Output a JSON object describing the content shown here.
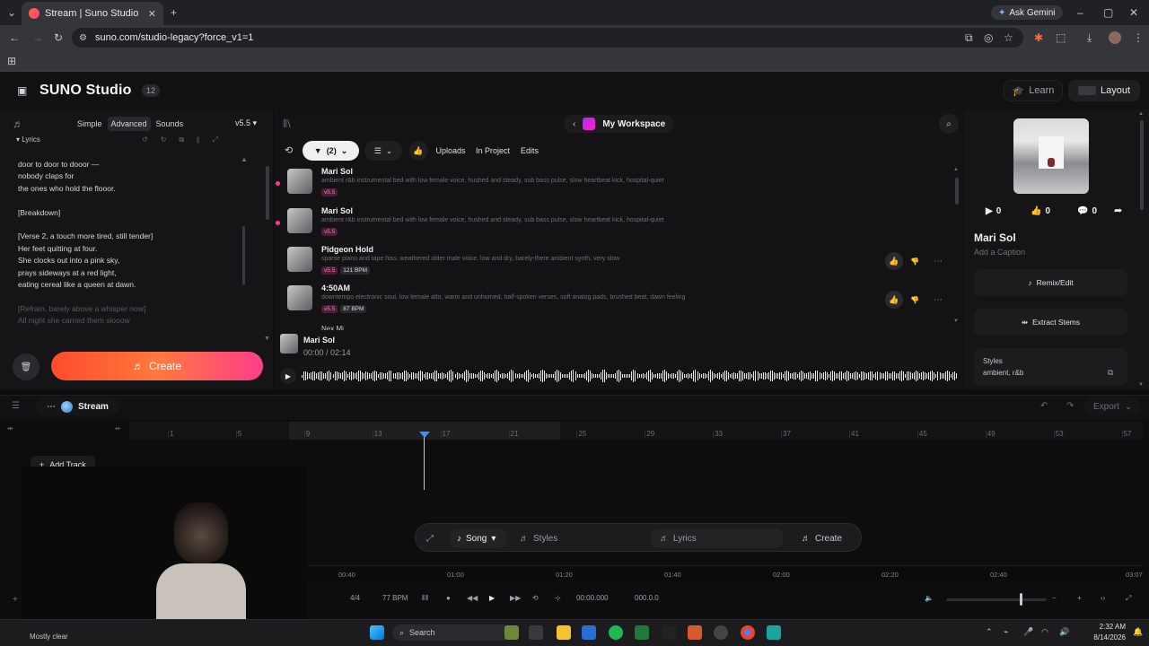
{
  "browser": {
    "tab_title": "Stream | Suno Studio",
    "url": "suno.com/studio-legacy?force_v1=1",
    "ask_gemini": "Ask Gemini"
  },
  "header": {
    "logo": "SUNO Studio",
    "badge": "12",
    "learn": "Learn",
    "layout": "Layout"
  },
  "left": {
    "tabs": [
      "Simple",
      "Advanced",
      "Sounds"
    ],
    "version": "v5.5",
    "lyrics_label": "Lyrics",
    "lyrics_lines": [
      {
        "t": "door to door to dooor —",
        "dim": false
      },
      {
        "t": "nobody claps for",
        "dim": false
      },
      {
        "t": "the ones who hold the flooor.",
        "dim": false
      },
      {
        "t": "",
        "dim": false
      },
      {
        "t": "[Breakdown]",
        "dim": false
      },
      {
        "t": "",
        "dim": false
      },
      {
        "t": "[Verse 2, a touch more tired, still tender]",
        "dim": false
      },
      {
        "t": "Her feet quitting at four.",
        "dim": false
      },
      {
        "t": "She clocks out into a pink sky,",
        "dim": false
      },
      {
        "t": "prays sideways at a red light,",
        "dim": false
      },
      {
        "t": "eating cereal like a queen at dawn.",
        "dim": false
      },
      {
        "t": "",
        "dim": false
      },
      {
        "t": "[Refrain, barely above a whisper now]",
        "dim": true
      },
      {
        "t": "All night she carried them slooow",
        "dim": true
      }
    ],
    "create": "Create"
  },
  "mid": {
    "workspace": "My Workspace",
    "filter_count": "(2)",
    "filters": [
      "Uploads",
      "In Project",
      "Edits"
    ],
    "songs": [
      {
        "title": "Mari Sol",
        "desc": "ambient r&b instrumental bed with low female voice, hushed and steady, sub bass pulse, slow heartbeat kick, hospital-quiet",
        "version": "v5.5",
        "bpm": ""
      },
      {
        "title": "Mari Sol",
        "desc": "ambient r&b instrumental bed with low female voice, hushed and steady, sub bass pulse, slow heartbeat kick, hospital-quiet",
        "version": "v5.5",
        "bpm": ""
      },
      {
        "title": "Pidgeon Hold",
        "desc": "sparse piano and tape hiss, weathered older male voice, low and dry, barely-there ambient synth, very slow",
        "version": "v5.5",
        "bpm": "121 BPM"
      },
      {
        "title": "4:50AM",
        "desc": "downtempo electronic soul, low female alto, warm and unhurried, half-spoken verses, soft analog pads, brushed beat, dawn feeling",
        "version": "v5.5",
        "bpm": "87 BPM"
      }
    ],
    "player_title": "Mari Sol",
    "player_time": "00:00 / 02:14"
  },
  "right": {
    "plays": "0",
    "likes": "0",
    "comments": "0",
    "title": "Mari Sol",
    "caption": "Add a Caption",
    "remix": "Remix/Edit",
    "stems": "Extract Stems",
    "styles_label": "Styles",
    "styles_value": "ambient, r&b"
  },
  "timeline": {
    "project": "Stream",
    "export": "Export",
    "add_track": "Add Track",
    "bars": [
      "1",
      "5",
      "9",
      "13",
      "17",
      "21",
      "25",
      "29",
      "33",
      "37",
      "41",
      "45",
      "49",
      "53",
      "57"
    ],
    "times": [
      "00:40",
      "01:00",
      "01:20",
      "01:40",
      "02:00",
      "02:20",
      "02:40",
      "03:07"
    ],
    "prompt": {
      "mode": "Song",
      "styles": "Styles",
      "lyrics": "Lyrics",
      "create": "Create"
    },
    "transport": {
      "sig": "4/4",
      "bpm": "77 BPM",
      "time": "00:00.000",
      "pos": "000.0.0"
    }
  },
  "taskbar": {
    "weather": "Mostly clear",
    "search": "Search",
    "time": "2:32 AM",
    "date": "8/14/2026"
  },
  "colors": {
    "accent": "#ff4a2b",
    "pink": "#ff3d8b",
    "playhead": "#3b8cff"
  }
}
